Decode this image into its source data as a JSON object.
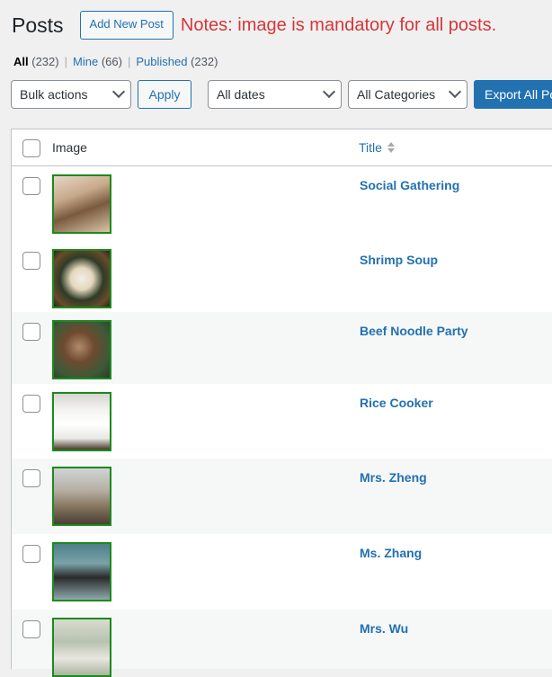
{
  "header": {
    "title": "Posts",
    "add_new_label": "Add New Post",
    "notes": "Notes: image is mandatory for all posts."
  },
  "views": {
    "all_label": "All",
    "all_count": "(232)",
    "mine_label": "Mine",
    "mine_count": "(66)",
    "published_label": "Published",
    "published_count": "(232)",
    "separator": "|"
  },
  "filters": {
    "bulk_actions": "Bulk actions",
    "apply": "Apply",
    "dates": "All dates",
    "categories": "All Categories",
    "export": "Export All Po"
  },
  "table": {
    "col_image": "Image",
    "col_title": "Title",
    "rows": [
      {
        "title": "Social Gathering",
        "image": "social-gathering-photo"
      },
      {
        "title": "Shrimp Soup",
        "image": "shrimp-soup-photo"
      },
      {
        "title": "Beef Noodle Party",
        "image": "beef-noodle-party-photo"
      },
      {
        "title": "Rice Cooker",
        "image": "rice-cooker-photo"
      },
      {
        "title": "Mrs. Zheng",
        "image": "mrs-zheng-photo"
      },
      {
        "title": "Ms. Zhang",
        "image": "ms-zhang-photo"
      },
      {
        "title": "Mrs. Wu",
        "image": "mrs-wu-photo"
      }
    ]
  },
  "colors": {
    "link": "#2271b1",
    "notes_red": "#d63638",
    "thumb_border": "#1c8a1c"
  }
}
